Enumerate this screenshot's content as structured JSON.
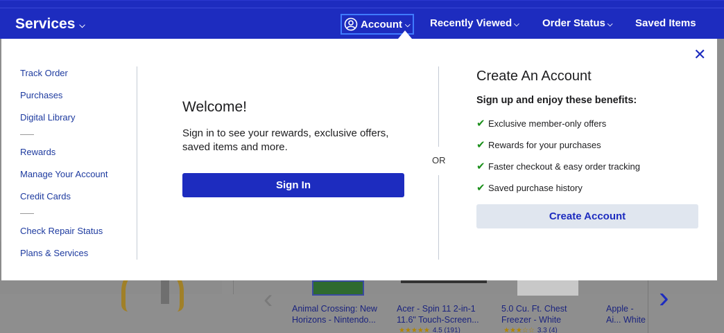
{
  "nav": {
    "services_label": "Services",
    "account_label": "Account",
    "recently_viewed_label": "Recently Viewed",
    "order_status_label": "Order Status",
    "saved_items_label": "Saved Items"
  },
  "left_menu": {
    "group1": [
      "Track Order",
      "Purchases",
      "Digital Library"
    ],
    "group2": [
      "Rewards",
      "Manage Your Account",
      "Credit Cards"
    ],
    "group3": [
      "Check Repair Status",
      "Plans & Services"
    ]
  },
  "welcome": {
    "title": "Welcome!",
    "description": "Sign in to see your rewards, exclusive offers, saved items and more.",
    "sign_in_label": "Sign In"
  },
  "or_label": "OR",
  "create": {
    "title": "Create An Account",
    "benefits_heading": "Sign up and enjoy these benefits:",
    "benefits": [
      "Exclusive member-only offers",
      "Rewards for your purchases",
      "Faster checkout & easy order tracking",
      "Saved purchase history"
    ],
    "button_label": "Create Account"
  },
  "background_products": [
    {
      "title": "Animal Crossing: New Horizons - Nintendo...",
      "rating": ""
    },
    {
      "title": "Acer - Spin 11 2-in-1 11.6\" Touch-Screen...",
      "rating": "4.5 (191)"
    },
    {
      "title": "5.0 Cu. Ft. Chest Freezer - White",
      "rating": "3.3 (4)"
    },
    {
      "title": "Apple - Ai... White",
      "rating": ""
    }
  ],
  "colors": {
    "brand_blue": "#1d2cbf",
    "check_green": "#1a8f1a",
    "secondary_button": "#e0e6ef"
  }
}
